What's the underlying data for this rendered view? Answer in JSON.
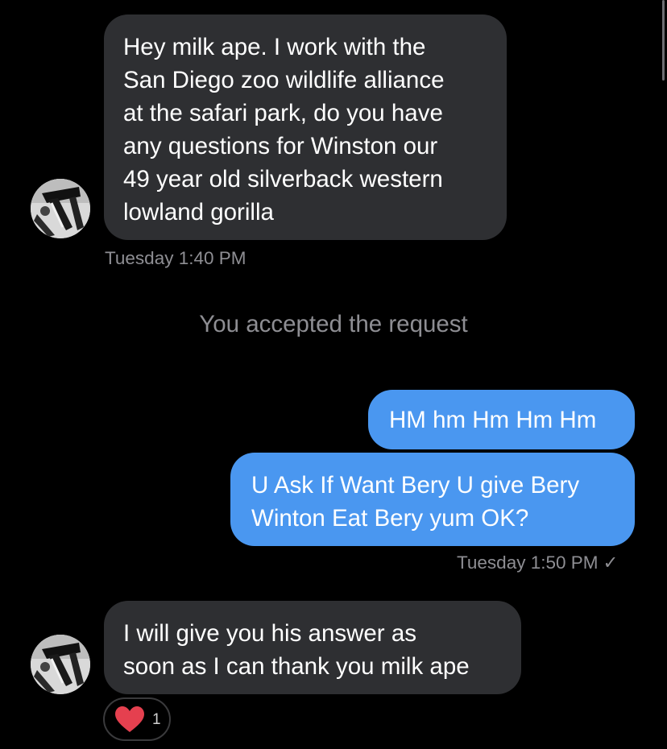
{
  "conversation": {
    "messages": [
      {
        "direction": "incoming",
        "text": "Hey milk ape. I work with the\nSan Diego zoo wildlife alliance\nat the safari park, do you have\nany questions for Winston our\n49 year old silverback western\nlowland gorilla",
        "timestamp": "Tuesday 1:40 PM"
      },
      {
        "direction": "system",
        "text": "You accepted the request"
      },
      {
        "direction": "outgoing",
        "text": "HM hm Hm Hm Hm"
      },
      {
        "direction": "outgoing",
        "text": "U Ask If Want Bery U give Bery\nWinton Eat Bery yum OK?",
        "timestamp": "Tuesday 1:50 PM",
        "read_mark": "✓"
      },
      {
        "direction": "incoming",
        "text": "I will give you his answer as\nsoon as I can thank you milk ape",
        "reaction": {
          "icon": "heart-icon",
          "count": "1"
        }
      }
    ]
  },
  "colors": {
    "background": "#000000",
    "incoming_bubble": "#2e2f32",
    "outgoing_bubble": "#4a97f0",
    "meta_text": "#8e8e93",
    "heart": "#e5404f"
  }
}
